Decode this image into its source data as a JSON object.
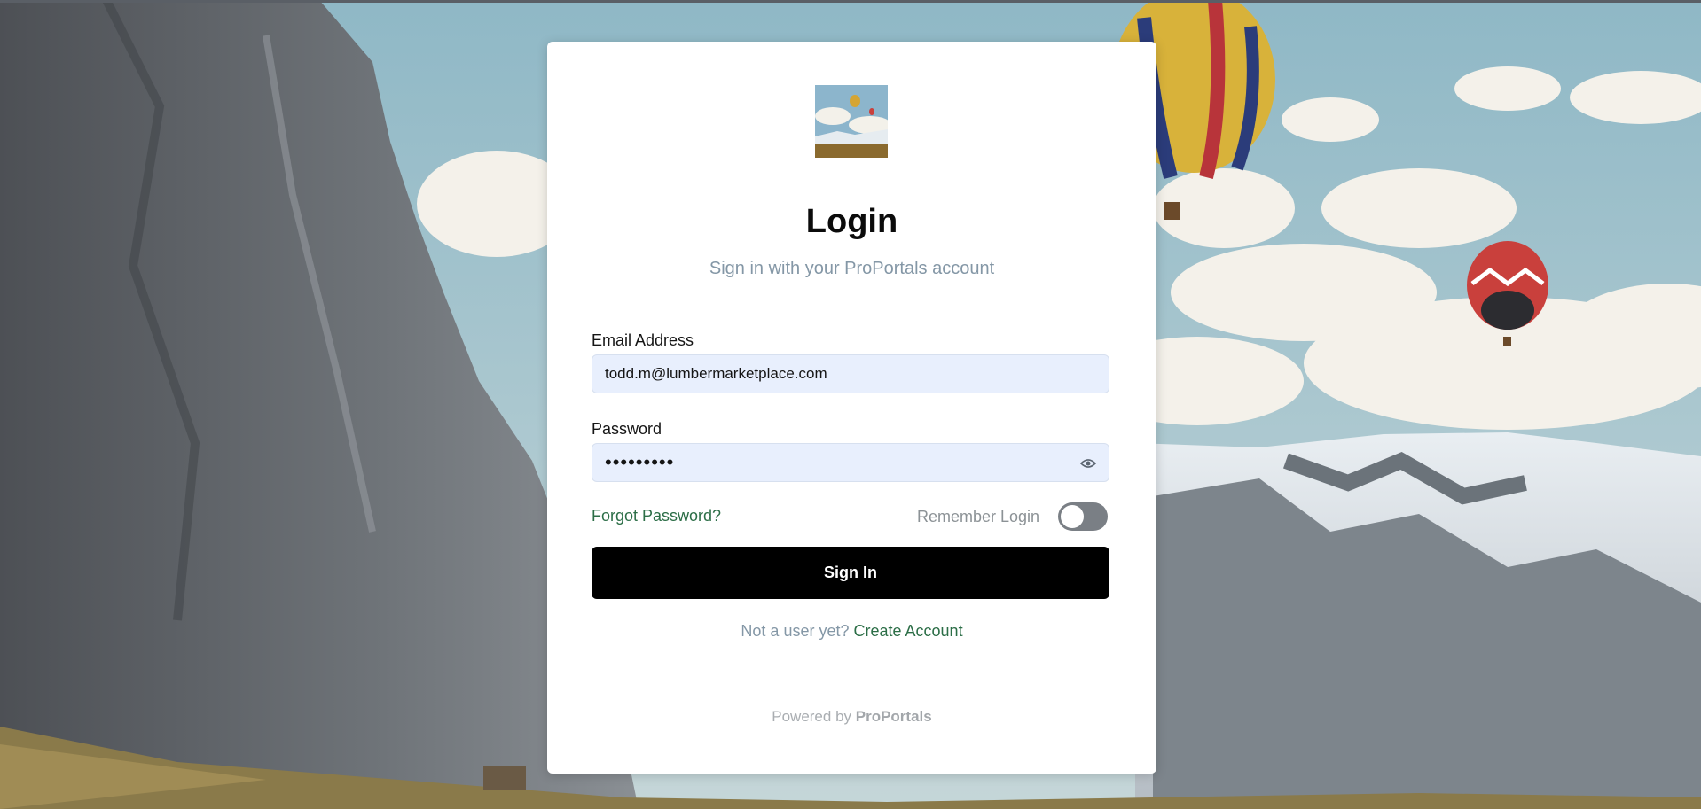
{
  "login": {
    "title": "Login",
    "subtitle": "Sign in with your ProPortals account",
    "email": {
      "label": "Email Address",
      "value": "todd.m@lumbermarketplace.com"
    },
    "password": {
      "label": "Password",
      "value": "•••••••••",
      "toggle_icon": "eye-icon"
    },
    "forgot_password": "Forgot Password?",
    "remember_login": {
      "label": "Remember Login",
      "on": false
    },
    "sign_in_button": "Sign In",
    "signup_prompt": "Not a user yet?",
    "create_account": "Create Account",
    "powered_by_prefix": "Powered by",
    "powered_by_brand": "ProPortals"
  },
  "colors": {
    "link": "#2c6e47",
    "button": "#000000",
    "input_bg": "#e8effd",
    "muted_text": "#8497a6"
  }
}
